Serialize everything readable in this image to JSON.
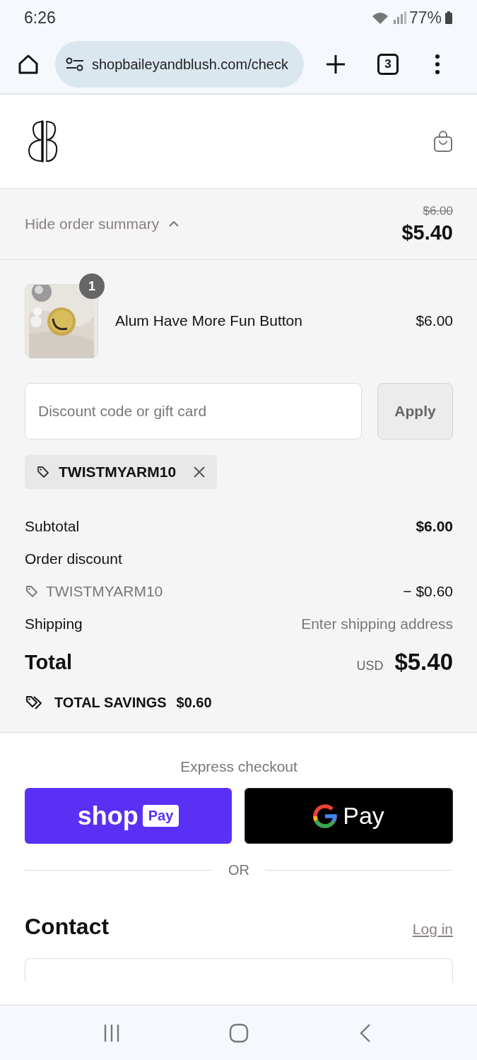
{
  "status_bar": {
    "time": "6:26",
    "battery": "77%"
  },
  "browser": {
    "url": "shopbaileyandblush.com/check",
    "tab_count": "3"
  },
  "summary_toggle": {
    "label": "Hide order summary",
    "expanded": true,
    "original_price": "$6.00",
    "price": "$5.40"
  },
  "items": [
    {
      "name": "Alum Have More Fun Button",
      "price": "$6.00",
      "quantity": "1",
      "kind": "picture"
    }
  ],
  "discount": {
    "placeholder": "Discount code or gift card",
    "button": "Apply",
    "applied_code": "TWISTMYARM10"
  },
  "totals": [
    {
      "label": "Subtotal",
      "value": "$6.00",
      "kind": "bold"
    },
    {
      "label": "Order discount",
      "kind": "heading"
    },
    {
      "label": "TWISTMYARM10",
      "value": "− $0.60",
      "kind": "code"
    },
    {
      "label": "Shipping",
      "value": "Enter shipping address",
      "kind": "muted"
    }
  ],
  "total": {
    "label": "Total",
    "currency": "USD",
    "value": "$5.40"
  },
  "savings": {
    "label": "TOTAL SAVINGS",
    "value": "$0.60"
  },
  "express": {
    "title": "Express checkout",
    "shop_pay": {
      "word": "shop",
      "badge": "Pay"
    },
    "google_pay": {
      "word": "Pay"
    },
    "divider": "OR"
  },
  "contact": {
    "title": "Contact",
    "link": "Log in"
  }
}
